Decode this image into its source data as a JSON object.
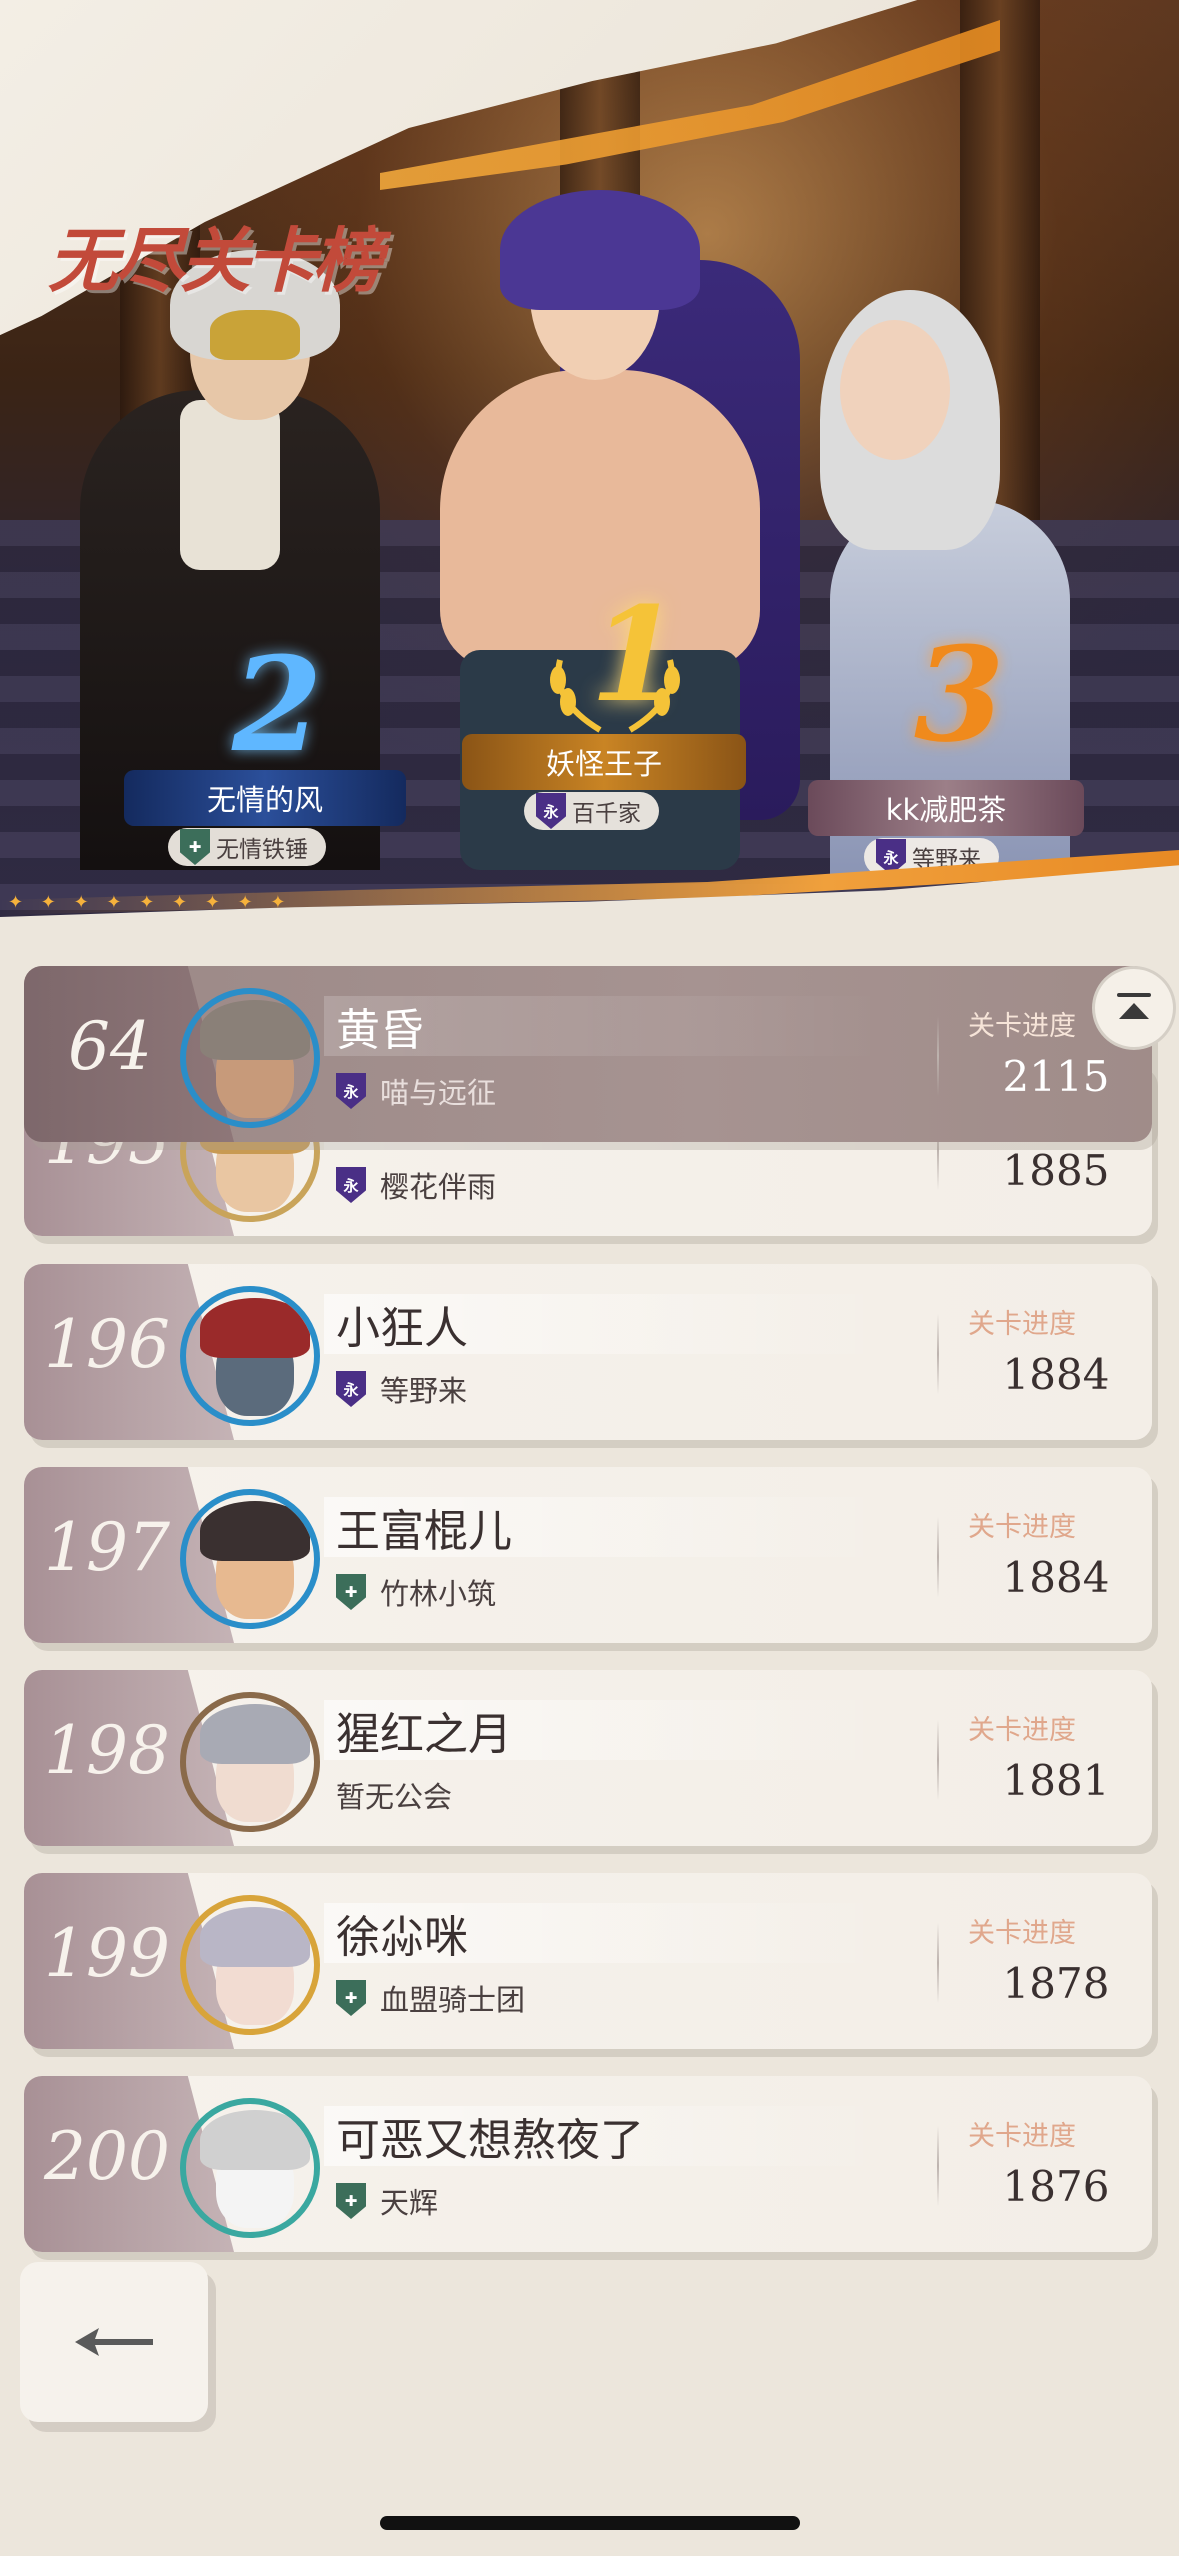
{
  "hero": {
    "title": "无尽关卡榜",
    "podium": [
      {
        "place": "2",
        "name": "无情的风",
        "guild": "无情铁锤",
        "guild_emblem_color": "#3c6e5a"
      },
      {
        "place": "1",
        "name": "妖怪王子",
        "guild": "百千家",
        "guild_emblem_color": "#4a2f86"
      },
      {
        "place": "3",
        "name": "kk减肥茶",
        "guild": "等野来",
        "guild_emblem_color": "#4a2f86"
      }
    ]
  },
  "list": {
    "progress_label": "关卡进度",
    "rows": [
      {
        "rank": "195",
        "name": "",
        "guild": "樱花伴雨",
        "progress": "1885",
        "emblem": "purple"
      },
      {
        "rank": "196",
        "name": "小狂人",
        "guild": "等野来",
        "progress": "1884",
        "emblem": "purple"
      },
      {
        "rank": "197",
        "name": "王富棍儿",
        "guild": "竹林小筑",
        "progress": "1884",
        "emblem": "green"
      },
      {
        "rank": "198",
        "name": "猩红之月",
        "guild": "暂无公会",
        "progress": "1881",
        "emblem": "none"
      },
      {
        "rank": "199",
        "name": "徐尛咪",
        "guild": "血盟骑士团",
        "progress": "1878",
        "emblem": "green"
      },
      {
        "rank": "200",
        "name": "可恶又想熬夜了",
        "guild": "天辉",
        "progress": "1876",
        "emblem": "green"
      }
    ],
    "my_row": {
      "rank": "64",
      "name": "黄昏",
      "guild": "喵与远征",
      "progress": "2115",
      "emblem": "purple"
    }
  },
  "controls": {
    "scroll_top_icon": "scroll-to-top-icon",
    "back_icon": "back-arrow-icon"
  },
  "colors": {
    "accent_orange": "#f0a03c",
    "progress_label": "#e0a78c",
    "highlight_row": "#a08c89"
  }
}
